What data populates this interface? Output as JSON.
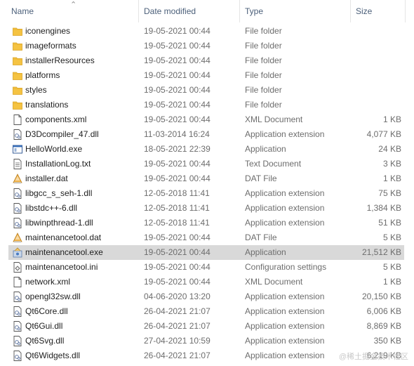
{
  "columns": {
    "name": "Name",
    "date": "Date modified",
    "type": "Type",
    "size": "Size"
  },
  "files": [
    {
      "name": "iconengines",
      "date": "19-05-2021 00:44",
      "type": "File folder",
      "size": "",
      "icon": "folder-icon"
    },
    {
      "name": "imageformats",
      "date": "19-05-2021 00:44",
      "type": "File folder",
      "size": "",
      "icon": "folder-icon"
    },
    {
      "name": "installerResources",
      "date": "19-05-2021 00:44",
      "type": "File folder",
      "size": "",
      "icon": "folder-icon"
    },
    {
      "name": "platforms",
      "date": "19-05-2021 00:44",
      "type": "File folder",
      "size": "",
      "icon": "folder-icon"
    },
    {
      "name": "styles",
      "date": "19-05-2021 00:44",
      "type": "File folder",
      "size": "",
      "icon": "folder-icon"
    },
    {
      "name": "translations",
      "date": "19-05-2021 00:44",
      "type": "File folder",
      "size": "",
      "icon": "folder-icon"
    },
    {
      "name": "components.xml",
      "date": "19-05-2021 00:44",
      "type": "XML Document",
      "size": "1 KB",
      "icon": "document-icon"
    },
    {
      "name": "D3Dcompiler_47.dll",
      "date": "11-03-2014 16:24",
      "type": "Application extension",
      "size": "4,077 KB",
      "icon": "dll-icon"
    },
    {
      "name": "HelloWorld.exe",
      "date": "18-05-2021 22:39",
      "type": "Application",
      "size": "24 KB",
      "icon": "exe-icon"
    },
    {
      "name": "InstallationLog.txt",
      "date": "19-05-2021 00:44",
      "type": "Text Document",
      "size": "3 KB",
      "icon": "text-file-icon"
    },
    {
      "name": "installer.dat",
      "date": "19-05-2021 00:44",
      "type": "DAT File",
      "size": "1 KB",
      "icon": "dat-file-icon"
    },
    {
      "name": "libgcc_s_seh-1.dll",
      "date": "12-05-2018 11:41",
      "type": "Application extension",
      "size": "75 KB",
      "icon": "dll-icon"
    },
    {
      "name": "libstdc++-6.dll",
      "date": "12-05-2018 11:41",
      "type": "Application extension",
      "size": "1,384 KB",
      "icon": "dll-icon"
    },
    {
      "name": "libwinpthread-1.dll",
      "date": "12-05-2018 11:41",
      "type": "Application extension",
      "size": "51 KB",
      "icon": "dll-icon"
    },
    {
      "name": "maintenancetool.dat",
      "date": "19-05-2021 00:44",
      "type": "DAT File",
      "size": "5 KB",
      "icon": "dat-file-icon"
    },
    {
      "name": "maintenancetool.exe",
      "date": "19-05-2021 00:44",
      "type": "Application",
      "size": "21,512 KB",
      "icon": "installer-exe-icon",
      "selected": true
    },
    {
      "name": "maintenancetool.ini",
      "date": "19-05-2021 00:44",
      "type": "Configuration settings",
      "size": "5 KB",
      "icon": "config-file-icon"
    },
    {
      "name": "network.xml",
      "date": "19-05-2021 00:44",
      "type": "XML Document",
      "size": "1 KB",
      "icon": "document-icon"
    },
    {
      "name": "opengl32sw.dll",
      "date": "04-06-2020 13:20",
      "type": "Application extension",
      "size": "20,150 KB",
      "icon": "dll-icon"
    },
    {
      "name": "Qt6Core.dll",
      "date": "26-04-2021 21:07",
      "type": "Application extension",
      "size": "6,006 KB",
      "icon": "dll-icon"
    },
    {
      "name": "Qt6Gui.dll",
      "date": "26-04-2021 21:07",
      "type": "Application extension",
      "size": "8,869 KB",
      "icon": "dll-icon"
    },
    {
      "name": "Qt6Svg.dll",
      "date": "27-04-2021 10:59",
      "type": "Application extension",
      "size": "350 KB",
      "icon": "dll-icon"
    },
    {
      "name": "Qt6Widgets.dll",
      "date": "26-04-2021 21:07",
      "type": "Application extension",
      "size": "6,219 KB",
      "icon": "dll-icon"
    }
  ],
  "watermark": "@稀土掘金技术社区",
  "colors": {
    "folder": "#f5c342",
    "selected_row": "#d9d9d9",
    "header_text": "#4c607a"
  }
}
